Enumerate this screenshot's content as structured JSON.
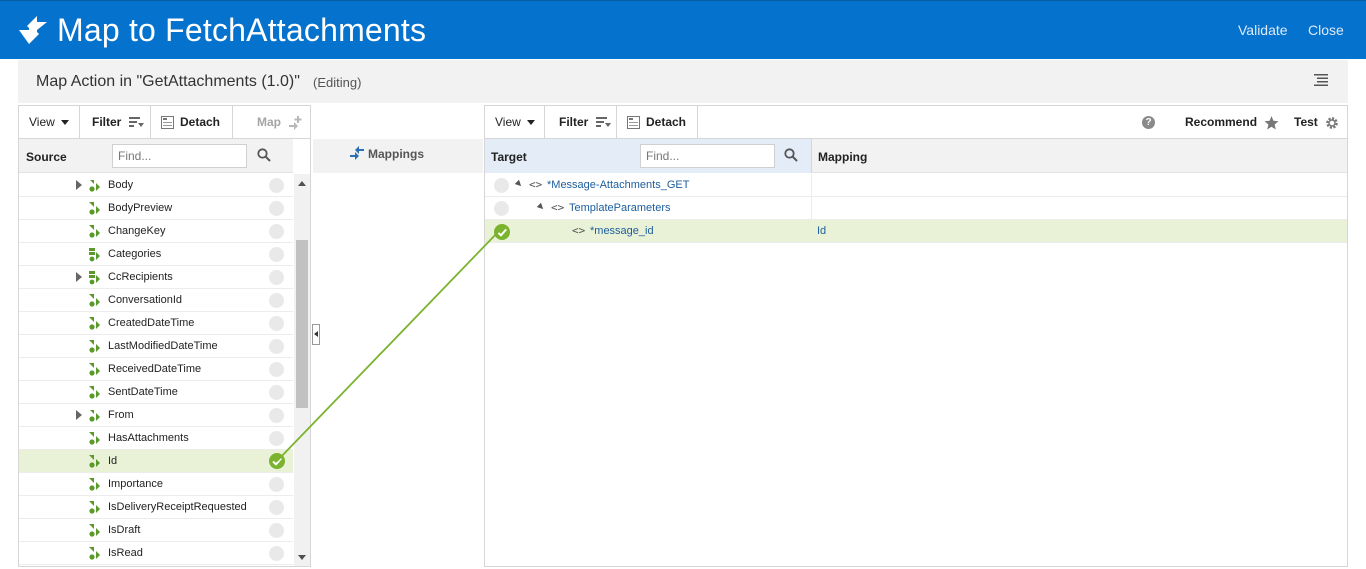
{
  "header": {
    "title": "Map to FetchAttachments",
    "validate_label": "Validate",
    "close_label": "Close"
  },
  "subbar": {
    "title": "Map Action in \"GetAttachments (1.0)\"",
    "status": "(Editing)"
  },
  "source": {
    "toolbar": {
      "view": "View",
      "filter": "Filter",
      "detach": "Detach",
      "map": "Map"
    },
    "column_label": "Source",
    "find_placeholder": "Find...",
    "rows": [
      {
        "label": "Body",
        "expandable": true,
        "icon": "collection-icon",
        "mapped": false
      },
      {
        "label": "BodyPreview",
        "expandable": false,
        "icon": "element-icon",
        "mapped": false
      },
      {
        "label": "ChangeKey",
        "expandable": false,
        "icon": "element-icon",
        "mapped": false
      },
      {
        "label": "Categories",
        "expandable": false,
        "icon": "repeating-icon",
        "mapped": false
      },
      {
        "label": "CcRecipients",
        "expandable": true,
        "icon": "repeating-icon",
        "mapped": false
      },
      {
        "label": "ConversationId",
        "expandable": false,
        "icon": "element-icon",
        "mapped": false
      },
      {
        "label": "CreatedDateTime",
        "expandable": false,
        "icon": "element-icon",
        "mapped": false
      },
      {
        "label": "LastModifiedDateTime",
        "expandable": false,
        "icon": "element-icon",
        "mapped": false
      },
      {
        "label": "ReceivedDateTime",
        "expandable": false,
        "icon": "element-icon",
        "mapped": false
      },
      {
        "label": "SentDateTime",
        "expandable": false,
        "icon": "element-icon",
        "mapped": false
      },
      {
        "label": "From",
        "expandable": true,
        "icon": "collection-icon",
        "mapped": false
      },
      {
        "label": "HasAttachments",
        "expandable": false,
        "icon": "element-icon",
        "mapped": false
      },
      {
        "label": "Id",
        "expandable": false,
        "icon": "element-icon",
        "mapped": true
      },
      {
        "label": "Importance",
        "expandable": false,
        "icon": "element-icon",
        "mapped": false
      },
      {
        "label": "IsDeliveryReceiptRequested",
        "expandable": false,
        "icon": "element-icon",
        "mapped": false
      },
      {
        "label": "IsDraft",
        "expandable": false,
        "icon": "element-icon",
        "mapped": false
      },
      {
        "label": "IsRead",
        "expandable": false,
        "icon": "element-icon",
        "mapped": false
      }
    ]
  },
  "mappings": {
    "label": "Mappings"
  },
  "target": {
    "toolbar": {
      "view": "View",
      "filter": "Filter",
      "detach": "Detach",
      "help": "?",
      "recommend": "Recommend",
      "test": "Test"
    },
    "column_label": "Target",
    "mapping_column_label": "Mapping",
    "find_placeholder": "Find...",
    "rows": [
      {
        "label": "*Message-Attachments_GET",
        "tag": "<>",
        "mapping": "",
        "mapped": false
      },
      {
        "label": "TemplateParameters",
        "tag": "<>",
        "mapping": "",
        "mapped": false
      },
      {
        "label": "*message_id",
        "tag": "<>",
        "mapping": "Id",
        "mapped": true
      }
    ]
  },
  "colors": {
    "header_bg": "#0572ce",
    "mapped_green": "#7bb32e",
    "selected_row": "#e9f2d6",
    "link_blue": "#1c5d9c"
  }
}
